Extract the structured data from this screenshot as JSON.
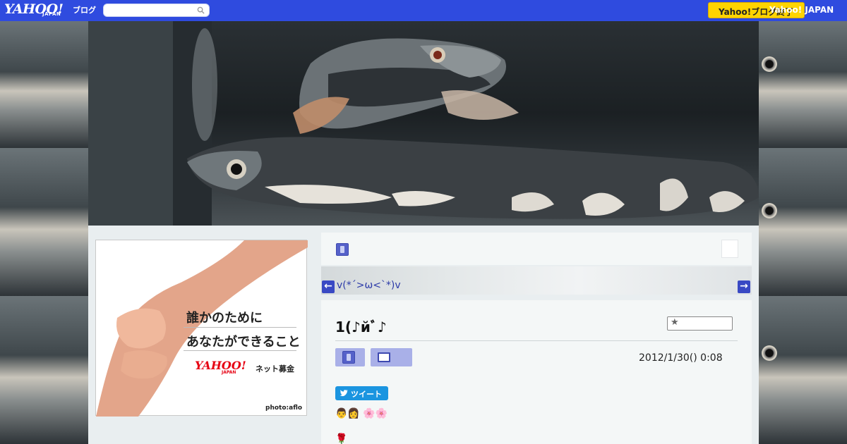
{
  "header": {
    "logo_text": "YAHOO!",
    "logo_sub": "JAPAN",
    "blog_label": "ブログ",
    "search_placeholder": "",
    "promo_button": "Yahoo!ブログ終了",
    "yahoo_japan_link": "Yahoo! JAPAN"
  },
  "ad": {
    "headline_line1": "誰かのために",
    "headline_line2": "あなたができること",
    "logo_text": "YAHOO!",
    "logo_sub": "JAPAN",
    "fundraise_label": "ネット募金",
    "credit": "photo:aflo"
  },
  "blog_nav": {
    "blog_title_link": "v(*´>ω<`*)v"
  },
  "article": {
    "title": "1(♪йﾞ♪",
    "date": "2012/1/30()  0:08",
    "tweet_label": "ツイート",
    "emoji_line1": "👨‍👩 🌸🌸",
    "emoji_line2": "🌹"
  },
  "colors": {
    "topbar": "#2f4bdf",
    "promo": "#ffd400",
    "accent_blue": "#3949c4",
    "tweet": "#1b95e0"
  },
  "icons": [
    "search-icon",
    "blog-icon",
    "prev-arrow-icon",
    "next-arrow-icon",
    "star-icon",
    "category-icon",
    "folder-icon",
    "twitter-bird-icon"
  ]
}
